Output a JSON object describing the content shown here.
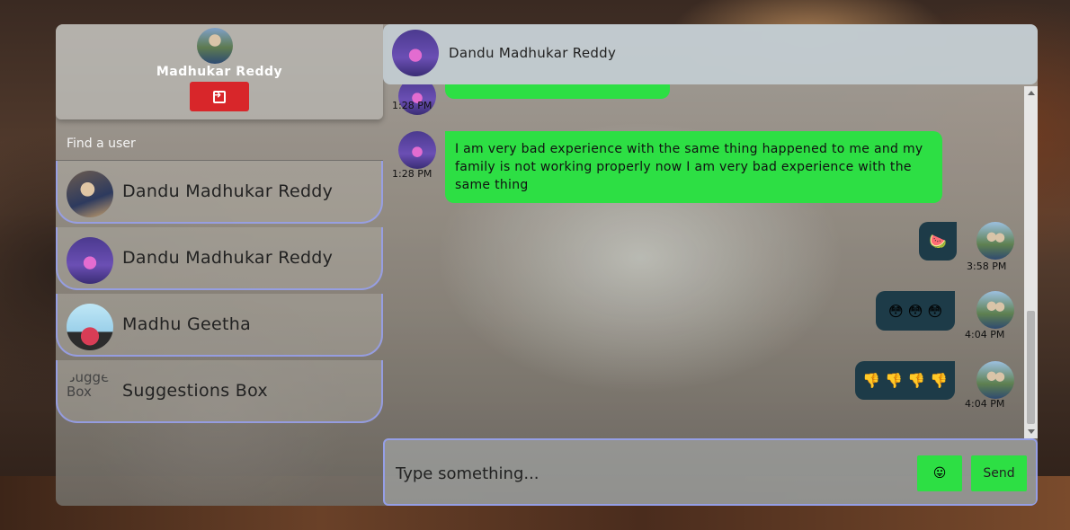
{
  "profile": {
    "name": "Madhukar Reddy",
    "logout_icon": "logout-icon"
  },
  "search": {
    "placeholder": "Find a user"
  },
  "users": [
    {
      "name": "Dandu Madhukar Reddy",
      "avatar_alt": ""
    },
    {
      "name": "Dandu Madhukar Reddy",
      "avatar_alt": ""
    },
    {
      "name": "Madhu Geetha",
      "avatar_alt": ""
    },
    {
      "name": "Suggestions Box",
      "avatar_alt": "Suggestions Box"
    }
  ],
  "chat": {
    "contact_name": "Dandu Madhukar Reddy",
    "messages": [
      {
        "side": "left",
        "time": "1:28 PM",
        "text": ""
      },
      {
        "side": "left",
        "time": "1:28 PM",
        "text": "I am very bad experience with the same thing happened to me and my family is not working properly now I am very bad experience with the same thing"
      },
      {
        "side": "right",
        "time": "3:58 PM",
        "text": "🍉"
      },
      {
        "side": "right",
        "time": "4:04 PM",
        "text": "😳 😳 😳"
      },
      {
        "side": "right",
        "time": "4:04 PM",
        "text": "👎 👎 👎 👎"
      }
    ]
  },
  "composer": {
    "placeholder": "Type something...",
    "emoji_label": "😛",
    "send_label": "Send"
  },
  "colors": {
    "accent_green": "#2ddf44",
    "logout_red": "#d8262a",
    "dark_bubble": "#1d3b48",
    "border_lavender": "#96a0f0"
  }
}
